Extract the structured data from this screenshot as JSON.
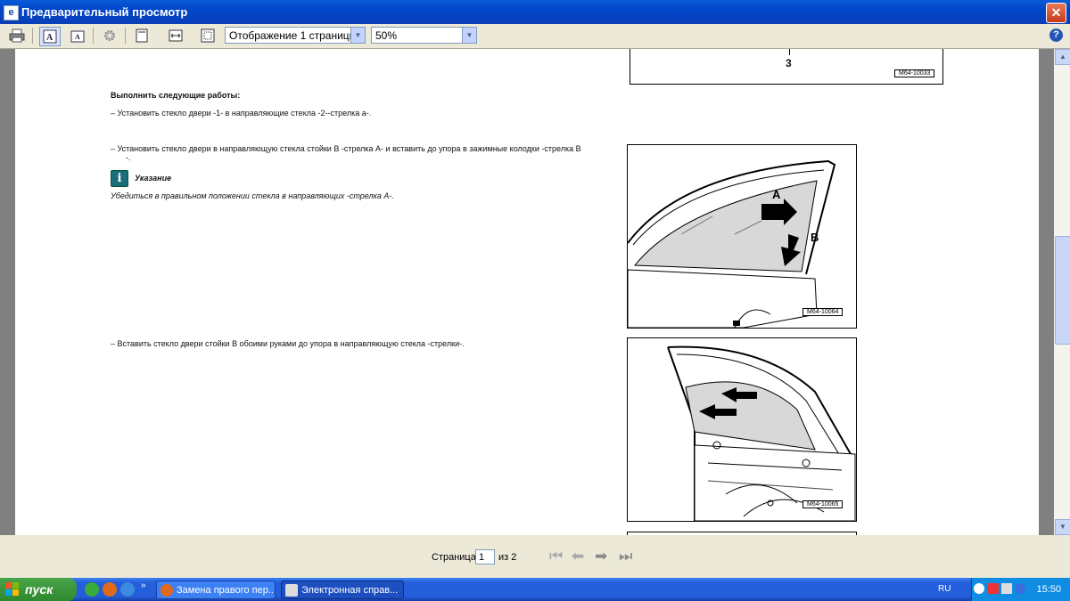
{
  "window": {
    "title": "Предварительный просмотр",
    "close_glyph": "✕"
  },
  "toolbar": {
    "display_mode": "Отображение 1 страницы",
    "zoom": "50%",
    "help_glyph": "?"
  },
  "document": {
    "top_figure_callout": "3",
    "top_figure_code": "M64-10033",
    "heading": "Выполнить следующие работы:",
    "step1": "–    Установить стекло двери -1- в направляющие стекла -2--стрелка а-.",
    "step2_line1": "–    Установить стекло двери в направляющую стекла стойки В -стрелка А- и вставить до упора в зажимные колодки -стрелка В",
    "step2_line2": "-.",
    "note_title": "Указание",
    "note_text": "Убедиться в правильном положении стекла в направляющих -стрелка А-.",
    "figure1_label_a": "A",
    "figure1_label_b": "B",
    "figure1_code": "M64-10064",
    "step3": "–    Вставить стекло двери стойки В обоими руками до упора в направляющую стекла -стрелки-.",
    "figure2_code": "M64-10065"
  },
  "pagination": {
    "label": "Страница",
    "current": "1",
    "of_label": "из 2"
  },
  "taskbar": {
    "start_label": "пуск",
    "tasks": [
      {
        "label": "Замена правого пер..."
      },
      {
        "label": "Электронная справ..."
      }
    ],
    "language": "RU",
    "clock": "15:50"
  },
  "colors": {
    "titlebar": "#0046c8",
    "taskbar": "#245edb",
    "start": "#2f8a2f",
    "note_icon": "#1a6e7a"
  }
}
